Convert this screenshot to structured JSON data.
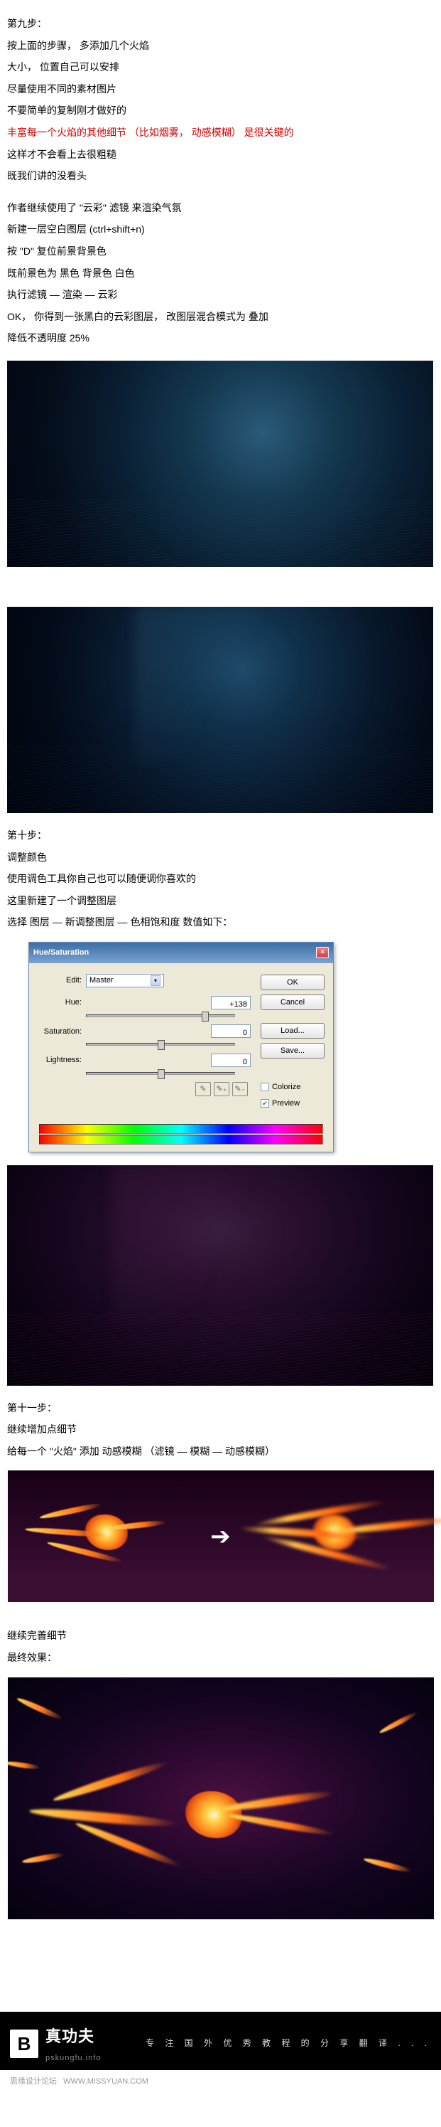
{
  "step9": {
    "title": "第九步：",
    "l1": "按上面的步骤， 多添加几个火焰",
    "l2": "大小， 位置自己可以安排",
    "l3": "尽量使用不同的素材图片",
    "l4": "不要简单的复制刚才做好的",
    "l5_red": "丰富每一个火焰的其他细节 （比如烟雾， 动感模糊） 是很关键的",
    "l6": "这样才不会看上去很粗糙",
    "l7": "既我们讲的没看头",
    "gap": "",
    "l8": "作者继续使用了 \"云彩\"  滤镜  来渲染气氛",
    "l9": "新建一层空白图层    (ctrl+shift+n)",
    "l10": "按 \"D\" 复位前景背景色",
    "l11": "既前景色为 黑色    背景色 白色",
    "l12": "执行滤镜 — 渲染 — 云彩",
    "l13": "OK， 你得到一张黑白的云彩图层， 改图层混合模式为   叠加",
    "l14": "降低不透明度 25%"
  },
  "step10": {
    "title": "第十步：",
    "l1": "调整颜色",
    "l2": "使用调色工具你自己也可以随便调你喜欢的",
    "l3": "这里新建了一个调整图层",
    "l4": "选择 图层 — 新调整图层 — 色相饱和度    数值如下："
  },
  "dialog": {
    "title": "Hue/Saturation",
    "edit_label": "Edit:",
    "edit_value": "Master",
    "hue_label": "Hue:",
    "hue_value": "+138",
    "sat_label": "Saturation:",
    "sat_value": "0",
    "light_label": "Lightness:",
    "light_value": "0",
    "ok": "OK",
    "cancel": "Cancel",
    "load": "Load...",
    "save": "Save...",
    "colorize": "Colorize",
    "preview": "Preview"
  },
  "step11": {
    "title": "第十一步：",
    "l1": "继续增加点细节",
    "l2": "给每一个 \"火焰\" 添加  动感模糊   （滤镜 — 模糊 — 动感模糊）"
  },
  "final": {
    "l1": "继续完善细节",
    "l2": "最终效果："
  },
  "arrows": {
    "down": "⬇",
    "right": "➔"
  },
  "footer": {
    "logo_b": "B",
    "brand": "真功夫",
    "domain": "pskungfu.info",
    "tagline": "专 注 国 外 优 秀 教 程 的 分 享 翻 译 . . .",
    "credit_site": "思缘设计论坛",
    "credit_url": "WWW.MISSYUAN.COM"
  }
}
